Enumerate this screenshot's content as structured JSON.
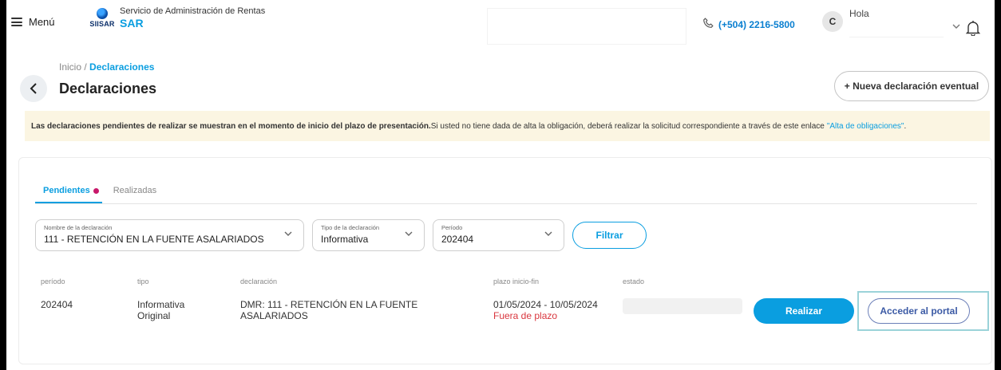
{
  "header": {
    "menu_label": "Menú",
    "logo_text": "SIISAR",
    "brand_subtitle": "Servicio de Administración de Rentas",
    "brand_name": "SAR",
    "phone": "(+504) 2216-5800",
    "avatar_initial": "C",
    "greeting": "Hola"
  },
  "page": {
    "breadcrumb_home": "Inicio",
    "breadcrumb_sep": " / ",
    "breadcrumb_current": "Declaraciones",
    "title": "Declaraciones",
    "new_button": "+ Nueva declaración eventual"
  },
  "notice": {
    "bold": "Las declaraciones pendientes de realizar se muestran en el momento de inicio del plazo de presentación.",
    "text": " Si usted no tiene dada de alta la obligación, deberá realizar la solicitud correspondiente a través de este enlace",
    "link": "\"Alta de obligaciones\"",
    "end": "."
  },
  "tabs": {
    "pending": "Pendientes",
    "done": "Realizadas"
  },
  "filters": {
    "name_label": "Nombre de la declaración",
    "name_value": "111 - RETENCIÓN EN LA FUENTE ASALARIADOS",
    "type_label": "Tipo de la declaración",
    "type_value": "Informativa",
    "period_label": "Período",
    "period_value": "202404",
    "filter_button": "Filtrar"
  },
  "table": {
    "headers": [
      "período",
      "tipo",
      "declaración",
      "plazo inicio-fin",
      "estado"
    ],
    "rows": [
      {
        "periodo": "202404",
        "tipo_1": "Informativa",
        "tipo_2": "Original",
        "declaracion_1": "DMR: 111 - RETENCIÓN EN LA FUENTE",
        "declaracion_2": "ASALARIADOS",
        "plazo": "01/05/2024 - 10/05/2024",
        "plazo_status": "Fuera de plazo",
        "realizar": "Realizar",
        "portal": "Acceder al portal"
      }
    ]
  },
  "colors": {
    "accent": "#0a9ee0",
    "notice_bg": "#fbf5e2",
    "danger": "#d9363e",
    "portal_border": "#6b7fb8"
  }
}
